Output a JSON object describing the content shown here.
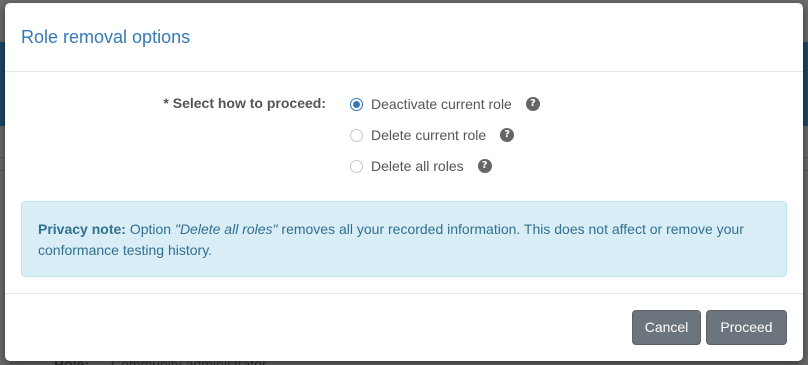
{
  "background": {
    "role_label": "Role:",
    "role_value": "Community administrator"
  },
  "modal": {
    "title": "Role removal options",
    "form_label": "* Select how to proceed:",
    "options": [
      {
        "label": "Deactivate current role",
        "checked": true,
        "help_icon": "question-circle-icon"
      },
      {
        "label": "Delete current role",
        "checked": false,
        "help_icon": "question-circle-icon"
      },
      {
        "label": "Delete all roles",
        "checked": false,
        "help_icon": "question-circle-icon"
      }
    ],
    "alert": {
      "heading": "Privacy note:",
      "text_before": " Option ",
      "quoted": "\"Delete all roles\"",
      "text_after": " removes all your recorded information. This does not affect or remove your conformance testing history."
    },
    "buttons": {
      "cancel": "Cancel",
      "proceed": "Proceed"
    }
  },
  "colors": {
    "title": "#337ab7",
    "radio_checked": "#337ab7",
    "alert_bg": "#d9edf7",
    "alert_text": "#31708f",
    "button_bg": "#6c757d"
  }
}
